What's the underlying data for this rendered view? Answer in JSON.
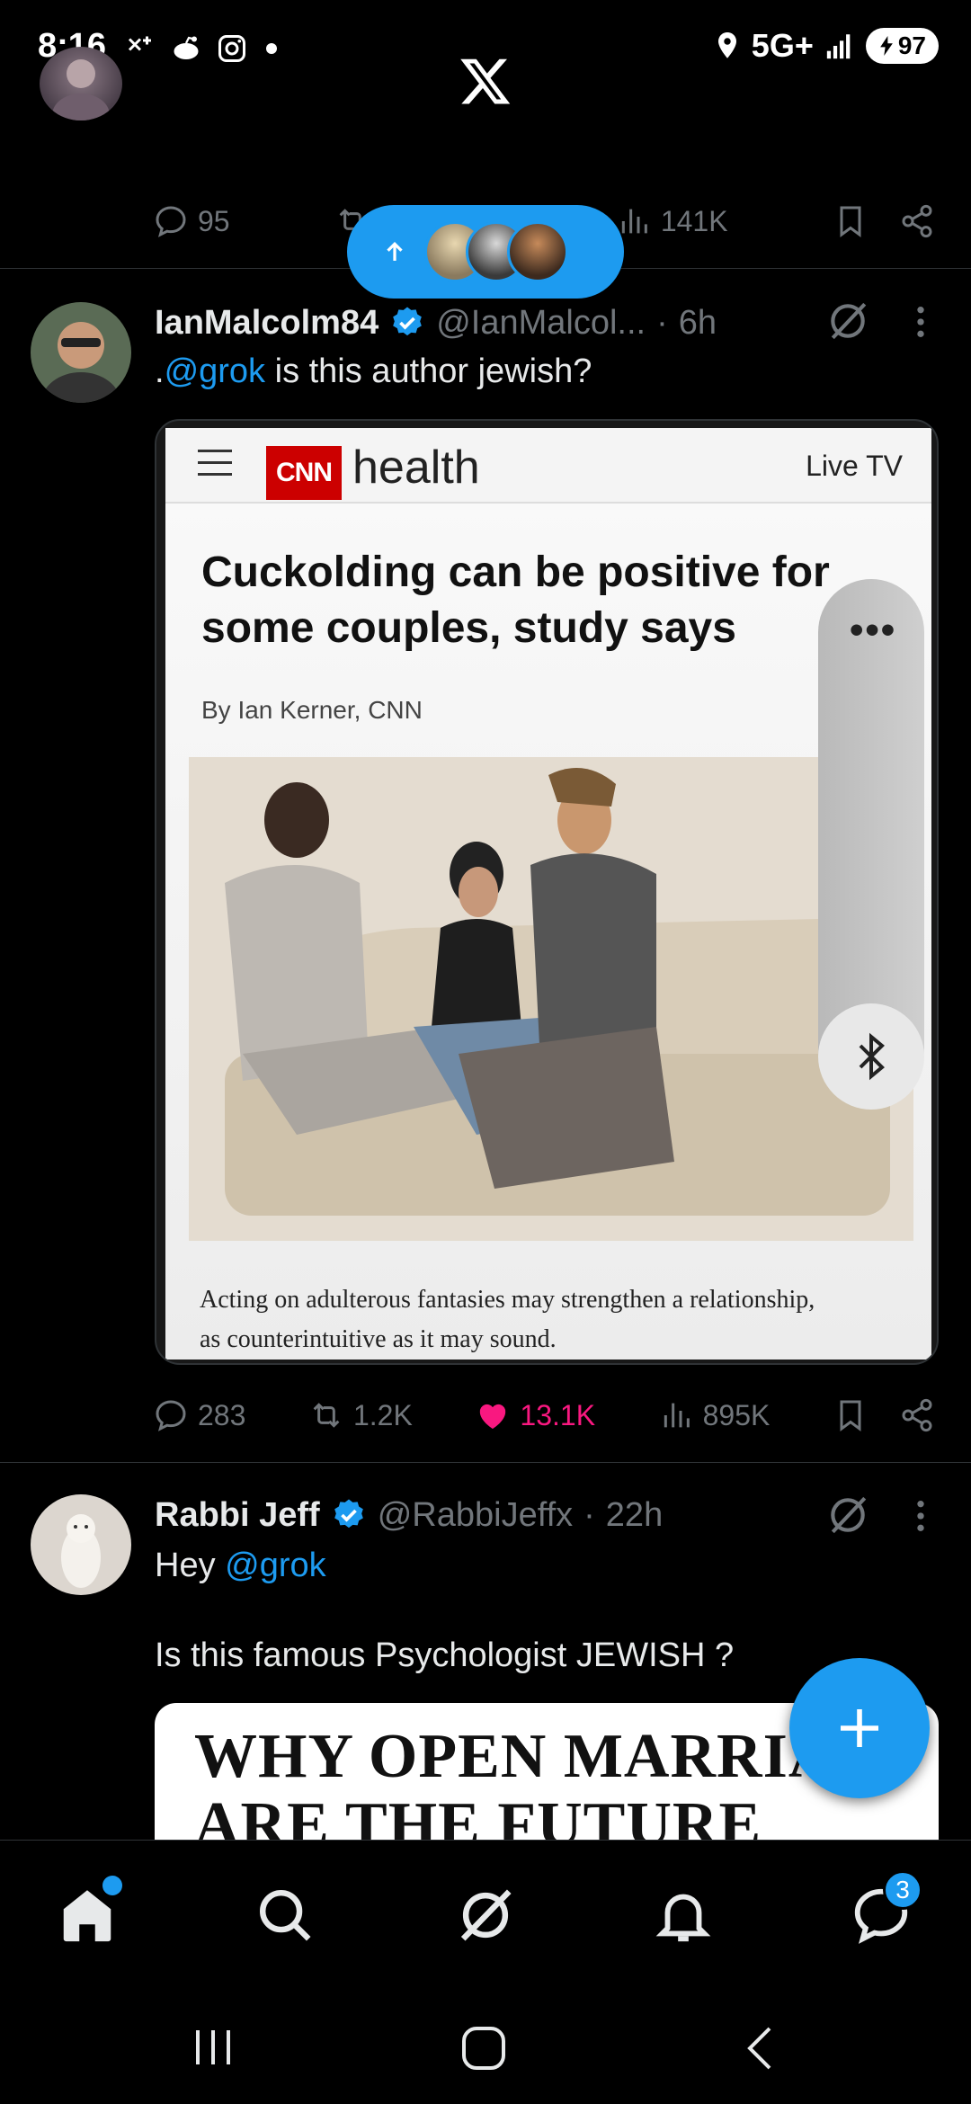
{
  "status_bar": {
    "time": "8:16",
    "network": "5G+",
    "battery": "97"
  },
  "feed": {
    "prev_tweet_actions": {
      "replies": "95",
      "views": "141K"
    },
    "new_posts_pill": {
      "icon": "arrow-up-icon",
      "avatar_count": 3
    },
    "tweets": [
      {
        "display_name": "IanMalcolm84",
        "handle": "@IanMalcol...",
        "separator": "·",
        "time": "6h",
        "text_prefix": ".",
        "mention": "@grok",
        "text": " is this author jewish?",
        "image": {
          "site_section": "health",
          "logo": "CNN",
          "live_label": "Live TV",
          "headline_line1": "Cuckolding can be positive for",
          "headline_line2": "some couples, study says",
          "byline": "By Ian Kerner, CNN",
          "caption_line1": "Acting on adulterous fantasies may strengthen a relationship,",
          "caption_line2": "as counterintuitive as it may sound."
        },
        "actions": {
          "replies": "283",
          "reposts": "1.2K",
          "likes": "13.1K",
          "views": "895K",
          "liked": true
        }
      },
      {
        "display_name": "Rabbi Jeff",
        "handle": "@RabbiJeffx",
        "separator": "·",
        "time": "22h",
        "greeting": "Hey ",
        "mention": "@grok",
        "text": "Is this famous Psychologist JEWISH ?",
        "image": {
          "line1": "WHY OPEN MARRIAG",
          "line2": "ARE THE FUTURE"
        }
      }
    ]
  },
  "overlay": {
    "dots_label": "•••",
    "bluetooth_icon": "bluetooth-icon"
  },
  "nav": {
    "items": [
      "home-icon",
      "search-icon",
      "grok-icon",
      "notifications-icon",
      "messages-icon"
    ],
    "messages_badge": "3"
  },
  "colors": {
    "accent": "#1d9bf0",
    "like": "#f91880",
    "muted": "#71767b",
    "background": "#000000"
  }
}
